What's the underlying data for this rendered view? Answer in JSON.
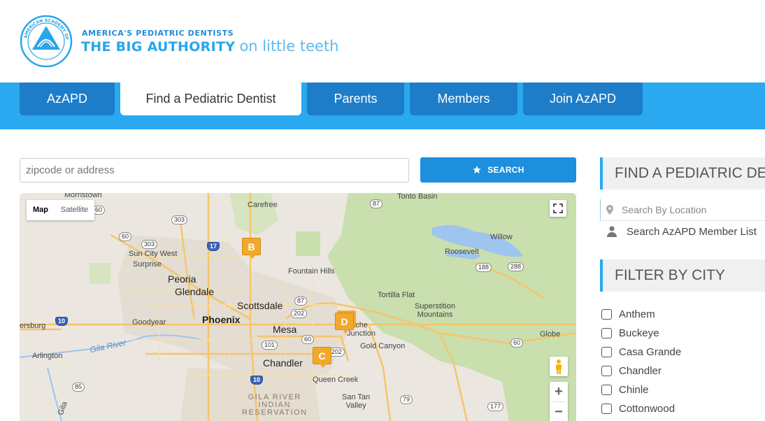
{
  "brand": {
    "seal_text": "AMERICAN ACADEMY OF PEDIATRIC DENTISTRY",
    "tagline_top": "AMERICA'S PEDIATRIC DENTISTS",
    "tagline_bold": "THE BIG AUTHORITY",
    "tagline_light": "on little teeth",
    "accent": "#2aa6ea"
  },
  "nav": {
    "tabs": [
      {
        "label": "AzAPD"
      },
      {
        "label": "Find a Pediatric Dentist",
        "active": true
      },
      {
        "label": "Parents"
      },
      {
        "label": "Members"
      },
      {
        "label": "Join AzAPD"
      }
    ]
  },
  "search": {
    "placeholder": "zipcode or address",
    "button_label": "SEARCH",
    "button_icon": "star-icon"
  },
  "map": {
    "type_controls": [
      "Map",
      "Satellite"
    ],
    "active_type": "Map",
    "zoom_in": "+",
    "zoom_out": "−",
    "places": {
      "morristown": "Morristown",
      "carefree": "Carefree",
      "tonto_basin": "Tonto Basin",
      "sun_city_west": "Sun City West",
      "surprise": "Surprise",
      "willow": "Willow",
      "roosevelt": "Roosevelt",
      "fountain_hills": "Fountain Hills",
      "peoria": "Peoria",
      "glendale": "Glendale",
      "tortilla_flat": "Tortilla Flat",
      "scottsdale": "Scottsdale",
      "superstition": "Superstition\nMountains",
      "goodyear": "Goodyear",
      "phoenix": "Phoenix",
      "mesa": "Mesa",
      "apache": "pache\nJunction",
      "buckeye": "ersburg",
      "globe": "Globe",
      "gold_canyon": "Gold Canyon",
      "arlington": "Arlington",
      "gila_river": "Gila River",
      "chandler": "Chandler",
      "queen_creek": "Queen Creek",
      "reservation": "GILA RIVER\nINDIAN\nRESERVATION",
      "san_tan": "San Tan\nValley",
      "gila_bend": "Gila"
    },
    "highways": [
      "60",
      "303",
      "60",
      "303",
      "17",
      "87",
      "188",
      "288",
      "87",
      "202",
      "10",
      "101",
      "202",
      "60",
      "60",
      "10",
      "79",
      "85",
      "177"
    ],
    "markers": [
      "B",
      "D",
      "C"
    ]
  },
  "sidebar": {
    "find_heading": "FIND A PEDIATRIC DE",
    "search_location_placeholder": "Search By Location",
    "member_list_label": "Search AzAPD Member List",
    "filter_heading": "FILTER BY CITY",
    "cities": [
      "Anthem",
      "Buckeye",
      "Casa Grande",
      "Chandler",
      "Chinle",
      "Cottonwood"
    ]
  }
}
